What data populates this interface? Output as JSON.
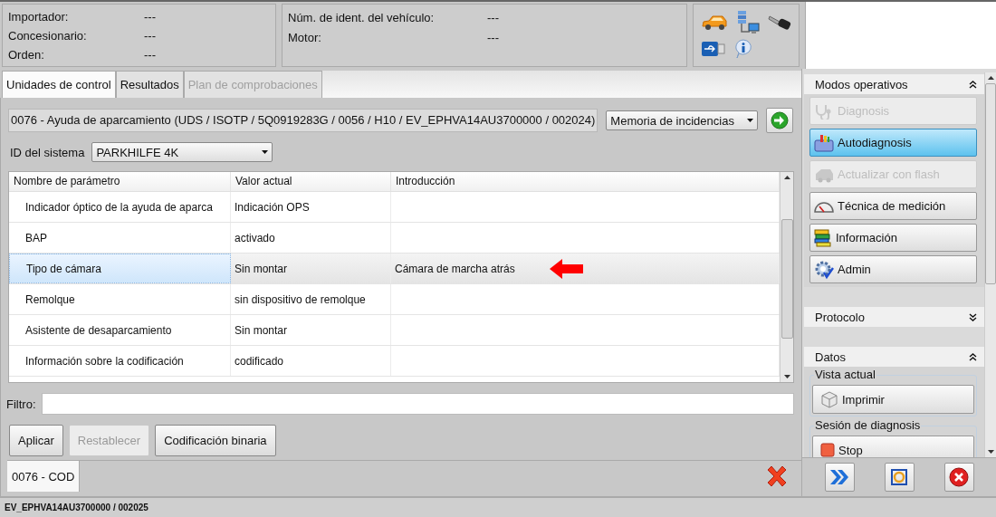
{
  "header": {
    "fields_left": [
      {
        "label": "Importador:",
        "value": "---"
      },
      {
        "label": "Concesionario:",
        "value": "---"
      },
      {
        "label": "Orden:",
        "value": "---"
      }
    ],
    "fields_right": [
      {
        "label": "Núm. de ident. del vehículo:",
        "value": "---"
      },
      {
        "label": "Motor:",
        "value": "---"
      }
    ]
  },
  "tabs": [
    {
      "label": "Unidades de control",
      "selected": true,
      "disabled": false
    },
    {
      "label": "Resultados",
      "selected": false,
      "disabled": false
    },
    {
      "label": "Plan de comprobaciones",
      "selected": false,
      "disabled": true
    }
  ],
  "control_unit": {
    "description": "0076 - Ayuda de aparcamiento  (UDS / ISOTP / 5Q0919283G / 0056 / H10 / EV_EPHVA14AU3700000 / 002024)",
    "function_select": "Memoria de incidencias"
  },
  "system_id": {
    "label": "ID del sistema",
    "value": "PARKHILFE 4K"
  },
  "table": {
    "columns": [
      "Nombre de parámetro",
      "Valor actual",
      "Introducción"
    ],
    "rows": [
      {
        "cells": [
          "Indicador óptico de la ayuda de aparca",
          "Indicación OPS",
          ""
        ],
        "selected": false,
        "marked": false
      },
      {
        "cells": [
          "BAP",
          "activado",
          ""
        ],
        "selected": false,
        "marked": false
      },
      {
        "cells": [
          "Tipo de cámara",
          "Sin montar",
          "Cámara de marcha atrás"
        ],
        "selected": true,
        "marked": true
      },
      {
        "cells": [
          "Remolque",
          "sin dispositivo de remolque",
          ""
        ],
        "selected": false,
        "marked": false
      },
      {
        "cells": [
          "Asistente de desaparcamiento",
          "Sin montar",
          ""
        ],
        "selected": false,
        "marked": false
      },
      {
        "cells": [
          "Información sobre la codificación",
          "codificado",
          ""
        ],
        "selected": false,
        "marked": false
      }
    ]
  },
  "filter": {
    "label": "Filtro:"
  },
  "buttons": [
    {
      "label": "Aplicar",
      "disabled": false
    },
    {
      "label": "Restablecer",
      "disabled": true
    },
    {
      "label": "Codificación binaria",
      "disabled": false
    }
  ],
  "bottom_tabs": [
    {
      "label": "0076 - COD",
      "selected": true
    }
  ],
  "sidebar": {
    "sections": [
      {
        "title": "Modos operativos",
        "expanded": true,
        "items": [
          {
            "label": "Diagnosis",
            "disabled": true,
            "selected": false
          },
          {
            "label": "Autodiagnosis",
            "disabled": false,
            "selected": true
          },
          {
            "label": "Actualizar con flash",
            "disabled": true,
            "selected": false
          },
          {
            "label": "Técnica de medición",
            "disabled": false,
            "selected": false
          },
          {
            "label": "Información",
            "disabled": false,
            "selected": false
          },
          {
            "label": "Admin",
            "disabled": false,
            "selected": false
          }
        ]
      },
      {
        "title": "Protocolo",
        "expanded": false
      },
      {
        "title": "Datos",
        "expanded": true,
        "groups": [
          {
            "title": "Vista actual",
            "items": [
              {
                "label": "Imprimir"
              }
            ]
          },
          {
            "title": "Sesión de diagnosis",
            "items": [
              {
                "label": "Stop"
              }
            ]
          }
        ]
      }
    ]
  },
  "status_bar": "EV_EPHVA14AU3700000 / 002025"
}
